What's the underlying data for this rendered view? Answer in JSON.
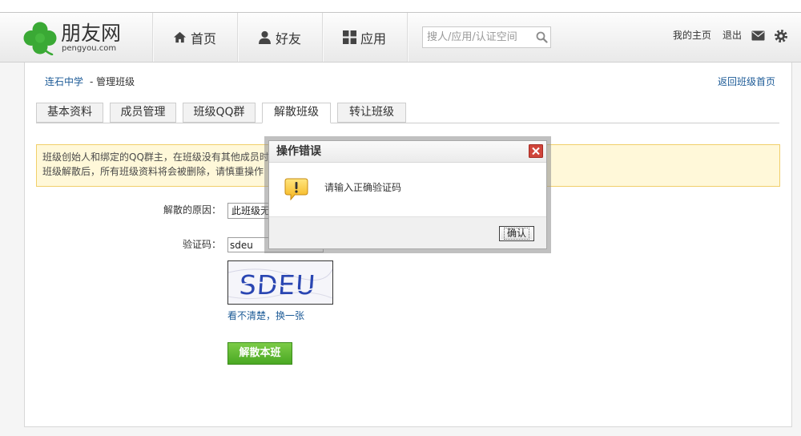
{
  "header": {
    "logo": {
      "title": "朋友网",
      "domain": "pengyou.com",
      "icon": "clover-logo-icon"
    },
    "nav": [
      {
        "label": "首页",
        "icon": "home-icon"
      },
      {
        "label": "好友",
        "icon": "user-icon"
      },
      {
        "label": "应用",
        "icon": "apps-grid-icon"
      }
    ],
    "search": {
      "placeholder": "搜人/应用/认证空间",
      "icon": "search-icon"
    },
    "user_links": {
      "my_home": "我的主页",
      "logout": "退出"
    },
    "tool_icons": [
      "mail-icon",
      "gear-icon"
    ]
  },
  "breadcrumb": {
    "school": "连石中学",
    "current": "- 管理班级"
  },
  "back_link": "返回班级首页",
  "tabs": [
    {
      "label": "基本资料"
    },
    {
      "label": "成员管理"
    },
    {
      "label": "班级QQ群"
    },
    {
      "label": "解散班级",
      "active": true
    },
    {
      "label": "转让班级"
    }
  ],
  "notice": {
    "lines": [
      "班级创始人和绑定的QQ群主，在班级没有其他成员时",
      "班级解散后，所有班级资料将会被删除，请慎重操作"
    ]
  },
  "form": {
    "reason_label": "解散的原因：",
    "reason_selected": "此班级无",
    "captcha_label": "验证码：",
    "captcha_input": "sdeu",
    "captcha_text": "SDEU",
    "refresh_link": "看不清楚，换一张",
    "submit_label": "解散本班"
  },
  "dialog": {
    "title": "操作错误",
    "icon": "warning-icon",
    "close_icon": "close-icon",
    "message": "请输入正确验证码",
    "confirm_label": "确认"
  },
  "colors": {
    "link_blue": "#1d5b97",
    "brand_green": "#3aa935",
    "button_green": "#4aa823",
    "notice_bg": "#fff8d9",
    "notice_border": "#f1cf6a",
    "close_red": "#d0453b"
  }
}
